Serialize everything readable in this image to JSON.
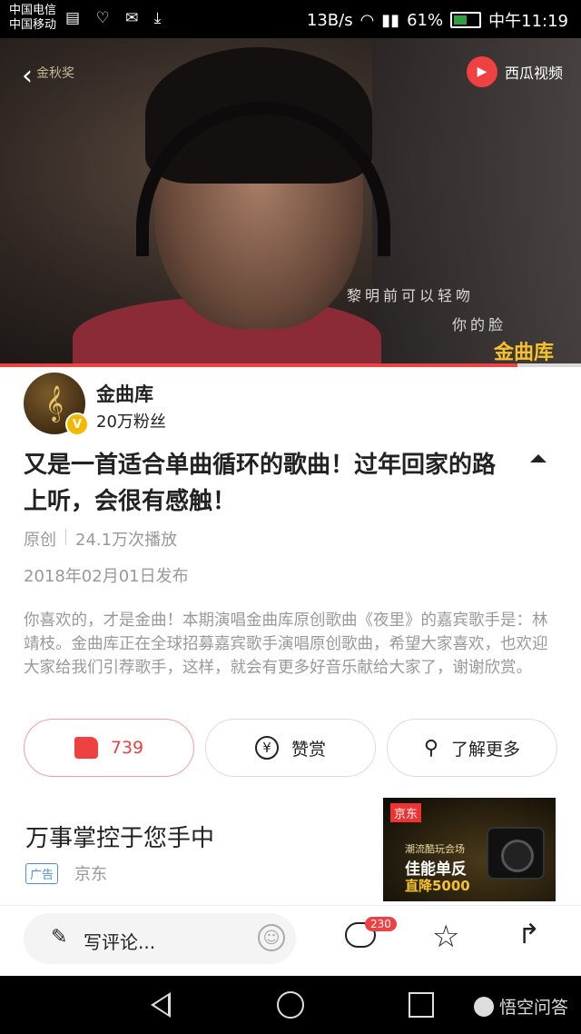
{
  "status_bar": {
    "carrier1": "中国电信",
    "carrier2": "中国移动",
    "speed": "13B/s",
    "battery": "61%",
    "battery_level": 0.61,
    "time": "中午11:19"
  },
  "video": {
    "source_label": "西瓜视频",
    "watermark_left": "金秋奖",
    "lyric_line1": "黎明前可以轻吻",
    "lyric_line2": "你的脸",
    "channel_watermark": "金曲库",
    "progress": 0.89
  },
  "author": {
    "name": "金曲库",
    "fans": "20万粉丝",
    "badge": "V"
  },
  "post": {
    "title": "又是一首适合单曲循环的歌曲！过年回家的路上听，会很有感触！",
    "origin": "原创",
    "plays": "24.1万次播放",
    "date": "2018年02月01日发布",
    "description": "你喜欢的，才是金曲！本期演唱金曲库原创歌曲《夜里》的嘉宾歌手是：林靖枝。金曲库正在全球招募嘉宾歌手演唱原创歌曲，希望大家喜欢，也欢迎大家给我们引荐歌手，这样，就会有更多好音乐献给大家了，谢谢欣赏。"
  },
  "actions": {
    "like_count": "739",
    "reward_label": "赞赏",
    "more_label": "了解更多"
  },
  "ad": {
    "title": "万事掌控于您手中",
    "tag": "广告",
    "brand": "京东",
    "image_brand": "京东",
    "image_line1": "潮流酷玩会场",
    "image_line2": "佳能单反",
    "image_line3": "直降5000"
  },
  "comment_bar": {
    "input_placeholder": "写评论...",
    "comment_count": "230"
  },
  "nav_bar": {
    "app_label": "悟空问答"
  },
  "colors": {
    "accent": "#f04142",
    "gold": "#f5c22b",
    "muted_text": "#999999"
  }
}
